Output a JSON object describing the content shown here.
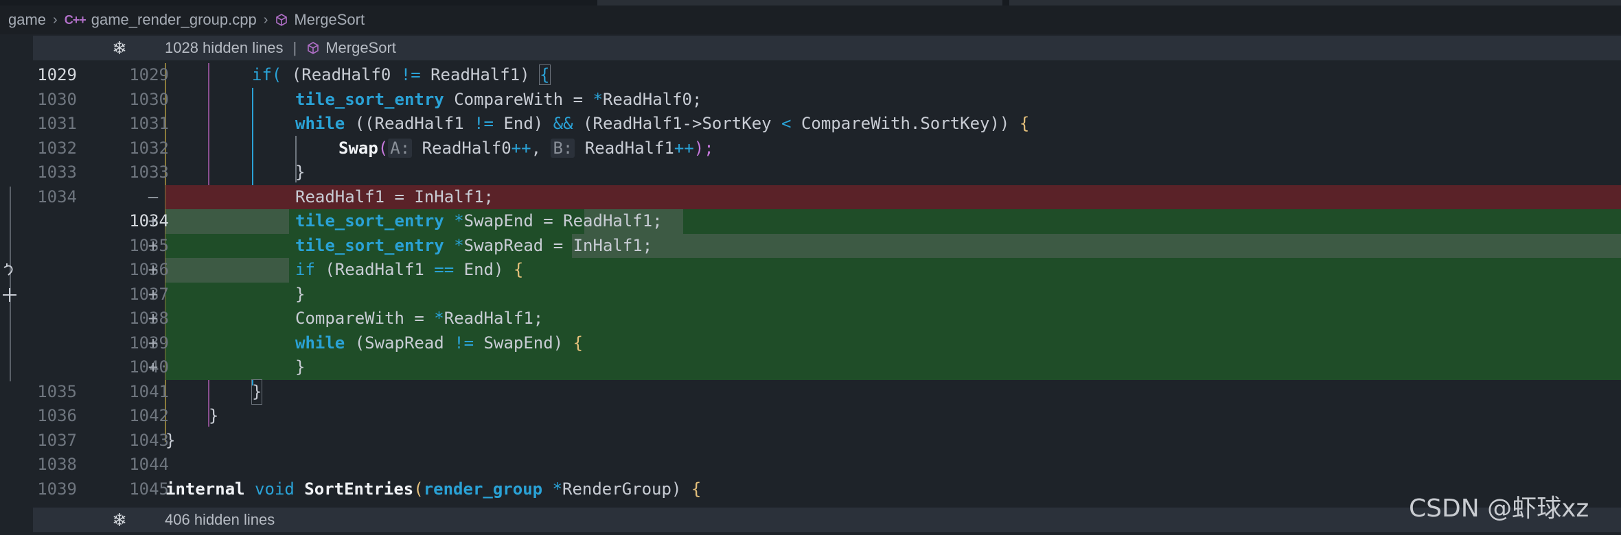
{
  "breadcrumb": {
    "folder": "game",
    "file_icon_text": "C++",
    "file": "game_render_group.cpp",
    "symbol": "MergeSort"
  },
  "hidden_top": {
    "label": "1028 hidden lines",
    "symbol": "MergeSort"
  },
  "hidden_bottom": {
    "label": "406 hidden lines"
  },
  "lines": [
    {
      "old": "1029",
      "new": "1029",
      "sign": ""
    },
    {
      "old": "1030",
      "new": "1030",
      "sign": ""
    },
    {
      "old": "1031",
      "new": "1031",
      "sign": ""
    },
    {
      "old": "1032",
      "new": "1032",
      "sign": ""
    },
    {
      "old": "1033",
      "new": "1033",
      "sign": ""
    },
    {
      "old": "1034",
      "new": "",
      "sign": "—"
    },
    {
      "old": "",
      "new": "1034",
      "sign": "+"
    },
    {
      "old": "",
      "new": "1035",
      "sign": "+"
    },
    {
      "old": "",
      "new": "1036",
      "sign": "+"
    },
    {
      "old": "",
      "new": "1037",
      "sign": "+"
    },
    {
      "old": "",
      "new": "1038",
      "sign": "+"
    },
    {
      "old": "",
      "new": "1039",
      "sign": "+"
    },
    {
      "old": "",
      "new": "1040",
      "sign": "+"
    },
    {
      "old": "1035",
      "new": "1041",
      "sign": ""
    },
    {
      "old": "1036",
      "new": "1042",
      "sign": ""
    },
    {
      "old": "1037",
      "new": "1043",
      "sign": ""
    },
    {
      "old": "1038",
      "new": "1044",
      "sign": ""
    },
    {
      "old": "1039",
      "new": "1045",
      "sign": ""
    }
  ],
  "code": {
    "l1029": {
      "kw": "if",
      "a": " (ReadHalf0 ",
      "op": "!=",
      "b": " ReadHalf1) ",
      "brace": "{"
    },
    "l1030": {
      "ty": "tile_sort_entry",
      "a": " CompareWith = ",
      "op": "*",
      "b": "ReadHalf0;"
    },
    "l1031": {
      "kw": "while",
      "a": " ((ReadHalf1 ",
      "op1": "!=",
      "b": " End) ",
      "op2": "&&",
      "c": " (ReadHalf1->SortKey ",
      "op3": "<",
      "d": " CompareWith.SortKey)) ",
      "brace": "{"
    },
    "l1032": {
      "fn": "Swap",
      "open": "(",
      "hintA": "A:",
      "a": " ReadHalf0",
      "pp1": "++",
      "comma": ", ",
      "hintB": "B:",
      "b": " ReadHalf1",
      "pp2": "++",
      "close": ");"
    },
    "l1033": {
      "brace": "}"
    },
    "l1034del": {
      "a": "ReadHalf1 = InHalf1;"
    },
    "l1034": {
      "ty": "tile_sort_entry",
      "op": " *",
      "a": "SwapEnd = ",
      "b": "ReadHalf1",
      "c": ";"
    },
    "l1035": {
      "ty": "tile_sort_entry",
      "op": " *",
      "a": "SwapRead",
      "b": " = InHalf1;"
    },
    "l1036": {
      "kw": "if",
      "a": " (ReadHalf1 ",
      "op": "==",
      "b": " End) ",
      "brace": "{"
    },
    "l1037": {
      "brace": "}"
    },
    "l1038": {
      "a": "CompareWith = ",
      "op": "*",
      "b": "ReadHalf1;"
    },
    "l1039": {
      "kw": "while",
      "a": " (SwapRead ",
      "op": "!=",
      "b": " SwapEnd) ",
      "brace": "{"
    },
    "l1040": {
      "brace": "}"
    },
    "l1041": {
      "brace": "}"
    },
    "l1042": {
      "brace": "}"
    },
    "l1043": {
      "brace": "}"
    },
    "l1045": {
      "kw1": "internal",
      "kw2": " void ",
      "fn": "SortEntries",
      "open": "(",
      "ty": "render_group",
      "op": " *",
      "a": "RenderGroup) ",
      "brace": "{"
    }
  },
  "watermark": "CSDN @虾球xz",
  "colors": {
    "deleted_bg": "#5a2228",
    "added_bg": "#1f4d28",
    "keyword": "#2aa2d6"
  }
}
